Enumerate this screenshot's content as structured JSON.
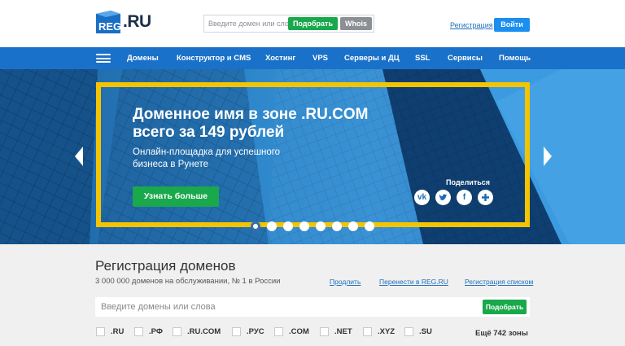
{
  "header": {
    "logo_text": "REG.RU",
    "search_placeholder": "Введите домен или слово",
    "find_label": "Подобрать",
    "whois_label": "Whois",
    "register_link": "Регистрация",
    "login_label": "Войти"
  },
  "nav": {
    "items": [
      "Домены",
      "Конструктор и CMS",
      "Хостинг",
      "VPS",
      "Серверы и ДЦ",
      "SSL",
      "Сервисы",
      "Помощь"
    ]
  },
  "hero": {
    "title": "Доменное имя в зоне .RU.COM\nвсего за 149 рублей",
    "subtitle": "Онлайн-площадка для успешного\nбизнеса в Рунете",
    "button": "Узнать больше",
    "share_label": "Поделиться",
    "share_icons": [
      "vk-icon",
      "twitter-icon",
      "facebook-icon",
      "plus-icon"
    ],
    "slides_total": 8,
    "active_slide": 1
  },
  "domains": {
    "title": "Регистрация доменов",
    "subtitle": "3 000 000 доменов на обслуживании, № 1 в России",
    "links": [
      "Продлить",
      "Перенести в REG.RU",
      "Регистрация списком"
    ],
    "search_placeholder": "Введите домены или слова",
    "find_label": "Подобрать",
    "zones": [
      ".RU",
      ".РФ",
      ".RU.COM",
      ".РУС",
      ".COM",
      ".NET",
      ".XYZ",
      ".SU"
    ],
    "more_zones": "Ещё 742 зоны"
  },
  "colors": {
    "nav_bg": "#1a71c9",
    "green": "#19a84b",
    "yellow_frame": "#f5c400",
    "login_blue": "#1a8ff0"
  }
}
